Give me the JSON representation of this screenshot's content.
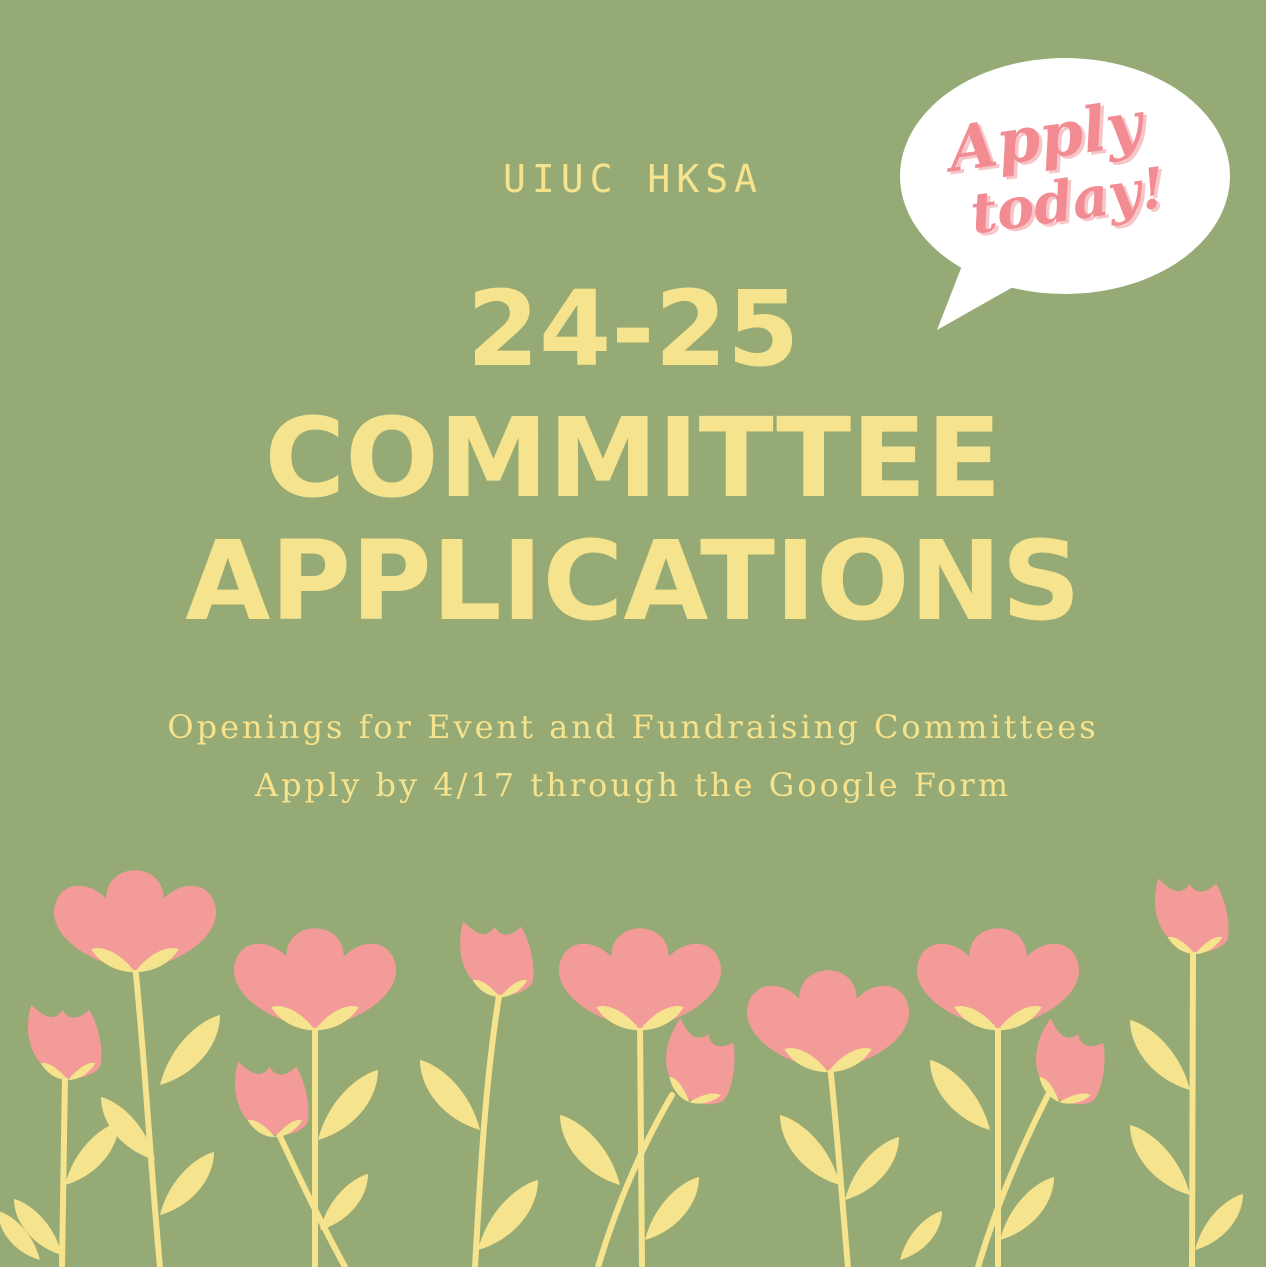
{
  "poster": {
    "organization": "UIUC HKSA",
    "headline_line1": "24-25",
    "headline_line2": "COMMITTEE",
    "headline_line3": "APPLICATIONS",
    "subtitle_line1": "Openings for Event and Fundraising Committees",
    "subtitle_line2": "Apply by 4/17 through the Google Form"
  },
  "bubble": {
    "line1": "Apply",
    "line2": "today!"
  },
  "colors": {
    "background": "#96aa75",
    "text_yellow": "#f6e38d",
    "flower_pink": "#f39b98",
    "bubble_text_pink": "#f28b92"
  }
}
